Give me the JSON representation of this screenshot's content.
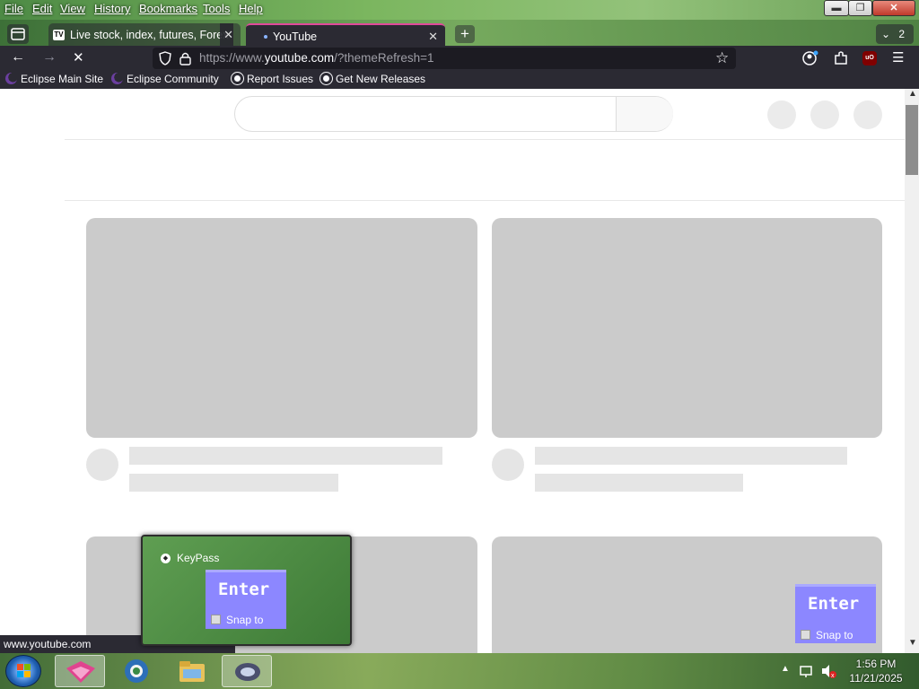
{
  "menu": {
    "file": "File",
    "edit": "Edit",
    "view": "View",
    "history": "History",
    "bookmarks": "Bookmarks",
    "tools": "Tools",
    "help": "Help"
  },
  "window_controls": {
    "minimize": "▬",
    "restore": "❐",
    "close": "✕"
  },
  "tabs": [
    {
      "title": "Live stock, index, futures, Forex",
      "icon": "tradingview-icon"
    },
    {
      "title": "YouTube",
      "icon": "youtube-loading-icon"
    }
  ],
  "tab_count": "2",
  "new_tab_label": "+",
  "url": {
    "prefix": "https://www.",
    "domain": "youtube.com",
    "suffix": "/?themeRefresh=1"
  },
  "bookmarks": [
    {
      "label": "Eclipse Main Site",
      "icon": "eclipse-icon"
    },
    {
      "label": "Eclipse Community",
      "icon": "eclipse-icon"
    },
    {
      "label": "Report Issues",
      "icon": "github-icon"
    },
    {
      "label": "Get New Releases",
      "icon": "github-icon"
    }
  ],
  "status_text": "www.youtube.com",
  "keypass": {
    "title": "KeyPass",
    "enter_label": "Enter",
    "snap_label": "Snap to"
  },
  "overlay_enter": {
    "enter_label": "Enter",
    "snap_label": "Snap to"
  },
  "clock": {
    "time": "1:56 PM",
    "date": "11/21/2025"
  },
  "colors": {
    "toolbar": "#2b2a33",
    "skeleton": "#cbcbcb",
    "enter_box": "#8c87ff",
    "active_tab_accent": "#e04a9a"
  }
}
